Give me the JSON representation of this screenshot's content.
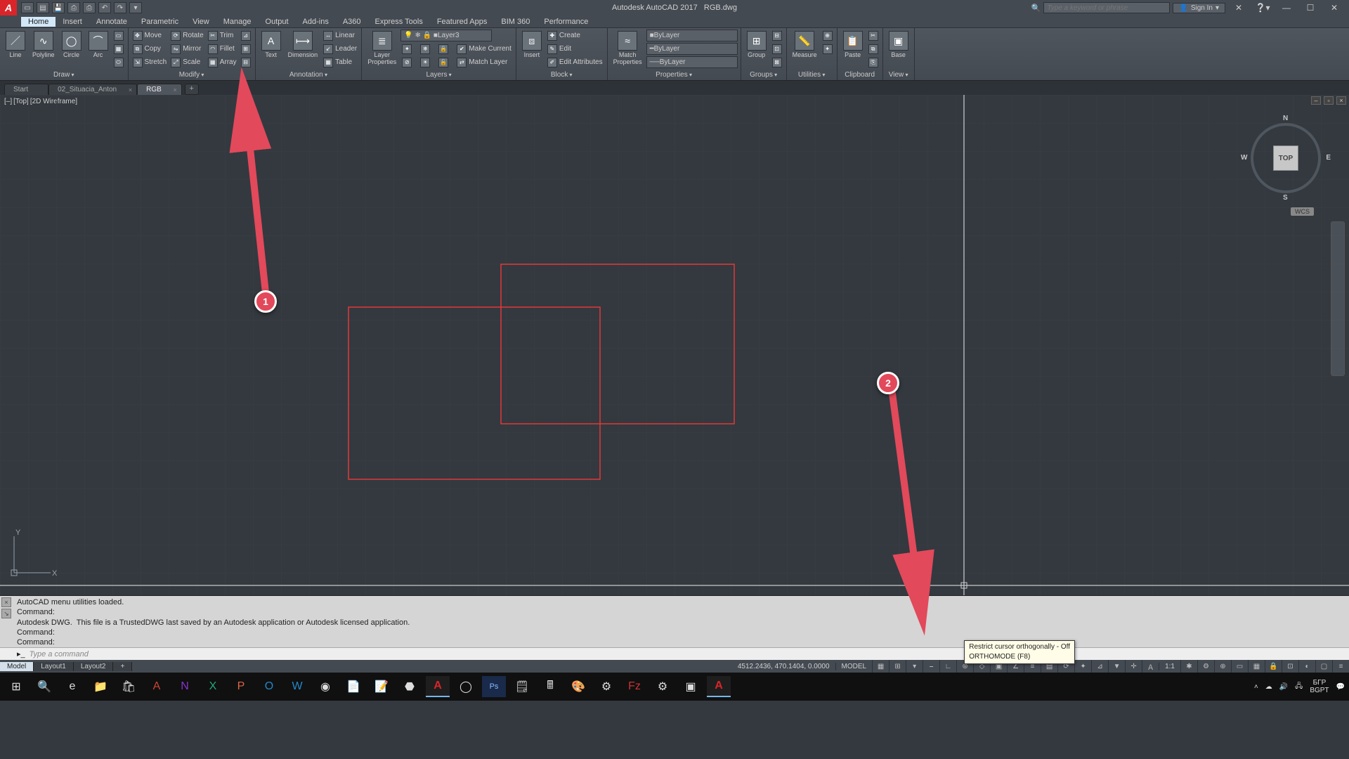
{
  "title": {
    "app": "Autodesk AutoCAD 2017",
    "doc": "RGB.dwg"
  },
  "searchPlaceholder": "Type a keyword or phrase",
  "signIn": "Sign In",
  "menu": [
    "Home",
    "Insert",
    "Annotate",
    "Parametric",
    "View",
    "Manage",
    "Output",
    "Add-ins",
    "A360",
    "Express Tools",
    "Featured Apps",
    "BIM 360",
    "Performance"
  ],
  "panels": {
    "draw": {
      "title": "Draw",
      "items": [
        "Line",
        "Polyline",
        "Circle",
        "Arc"
      ]
    },
    "modify": {
      "title": "Modify",
      "col1": [
        "Move",
        "Copy",
        "Stretch"
      ],
      "col2": [
        "Rotate",
        "Mirror",
        "Scale"
      ],
      "col3": [
        "Trim",
        "Fillet",
        "Array"
      ]
    },
    "annotation": {
      "title": "Annotation",
      "big": [
        "Text",
        "Dimension"
      ],
      "col": [
        "Linear",
        "Leader",
        "Table"
      ]
    },
    "layers": {
      "title": "Layers",
      "big": "Layer\nProperties",
      "dd": "Layer3",
      "items": [
        "Make Current",
        "Match Layer"
      ]
    },
    "block": {
      "title": "Block",
      "big": "Insert",
      "items": [
        "Create",
        "Edit",
        "Edit Attributes"
      ]
    },
    "properties": {
      "title": "Properties",
      "big": "Match\nProperties",
      "dd1": "ByLayer",
      "dd2": "ByLayer",
      "dd3": "ByLayer"
    },
    "groups": {
      "title": "Groups",
      "big": "Group"
    },
    "utilities": {
      "title": "Utilities",
      "big": "Measure"
    },
    "clipboard": {
      "title": "Clipboard",
      "big": "Paste"
    },
    "view": {
      "title": "View",
      "big": "Base"
    }
  },
  "docTabs": [
    "Start",
    "02_Situacia_Anton",
    "RGB"
  ],
  "activeDocTab": 2,
  "vpLabel": [
    "[–]",
    "[Top]",
    "[2D Wireframe]"
  ],
  "viewcube": {
    "top": "TOP",
    "n": "N",
    "s": "S",
    "e": "E",
    "w": "W",
    "wcs": "WCS"
  },
  "annotations": {
    "a1": "1",
    "a2": "2"
  },
  "cmdHistory": "AutoCAD menu utilities loaded.\nCommand:\nAutodesk DWG.  This file is a TrustedDWG last saved by an Autodesk application or Autodesk licensed application.\nCommand:\nCommand:\nCommand:",
  "cmdPrompt": "Type a command",
  "tooltip": {
    "line1": "Restrict cursor orthogonally - Off",
    "line2": "ORTHOMODE (F8)"
  },
  "layoutTabs": [
    "Model",
    "Layout1",
    "Layout2"
  ],
  "status": {
    "coords": "4512.2436, 470.1404, 0.0000",
    "space": "MODEL",
    "ratio": "1:1"
  },
  "tray": {
    "lang1": "БГР",
    "lang2": "BGPT",
    "time": ""
  }
}
